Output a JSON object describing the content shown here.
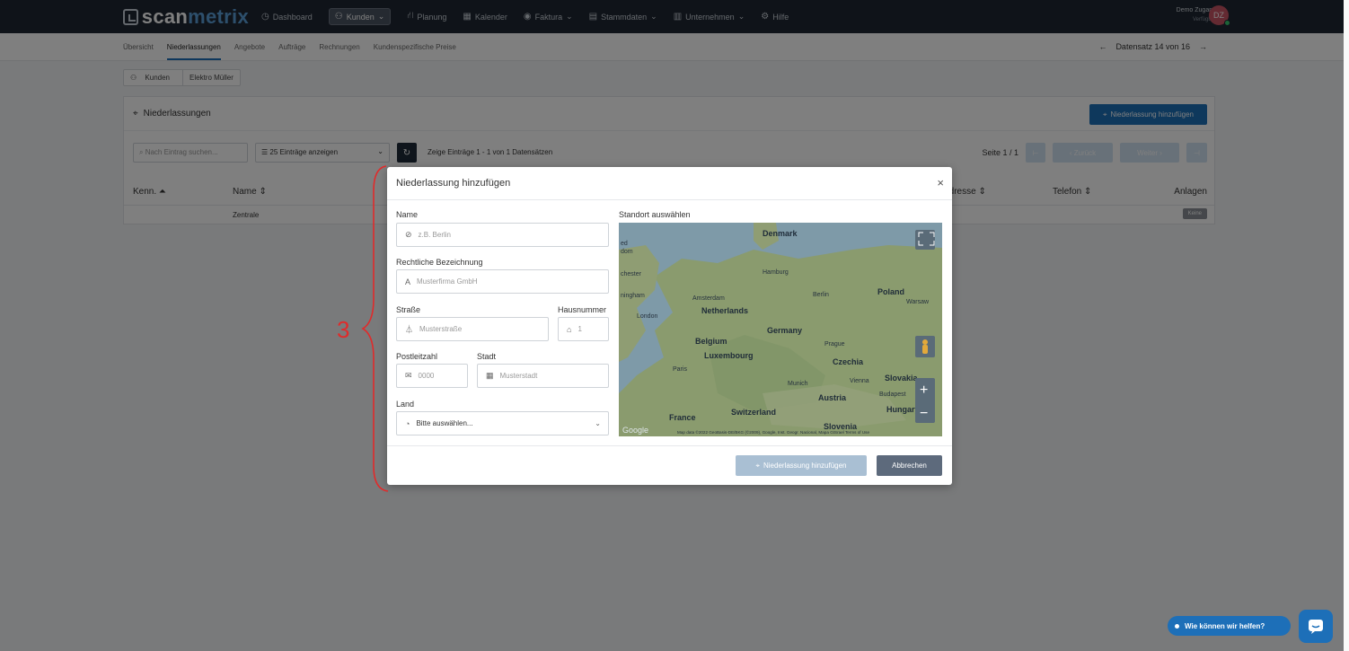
{
  "brand": {
    "part1": "scan",
    "part2": "metrix"
  },
  "nav": [
    {
      "label": "Dashboard",
      "icon": "dashboard-icon",
      "glyph": "◷"
    },
    {
      "label": "Kunden",
      "icon": "people-icon",
      "glyph": "⚇",
      "active": true,
      "chev": "⌄"
    },
    {
      "label": "Planung",
      "icon": "planning-icon",
      "glyph": "⛙"
    },
    {
      "label": "Kalender",
      "icon": "calendar-icon",
      "glyph": "▦"
    },
    {
      "label": "Faktura",
      "icon": "invoice-icon",
      "glyph": "◉",
      "chev": "⌄"
    },
    {
      "label": "Stammdaten",
      "icon": "database-icon",
      "glyph": "▤",
      "chev": "⌄"
    },
    {
      "label": "Unternehmen",
      "icon": "company-icon",
      "glyph": "▥",
      "chev": "⌄"
    },
    {
      "label": "Hilfe",
      "icon": "help-icon",
      "glyph": "⚙"
    }
  ],
  "user": {
    "name": "Demo Zugang",
    "status": "Verfügbar",
    "initials": "DZ"
  },
  "subnav": [
    "Übersicht",
    "Niederlassungen",
    "Angebote",
    "Aufträge",
    "Rechnungen",
    "Kundenspezifische Preise"
  ],
  "subnav_active": "Niederlassungen",
  "datensatz": {
    "prev": "←",
    "label": "Datensatz 14 von 16",
    "next": "→"
  },
  "breadcrumb": {
    "root": "Kunden",
    "current": "Elektro Müller"
  },
  "card": {
    "title": "Niederlassungen",
    "add_button": "Niederlassung hinzufügen",
    "search_placeholder": "Nach Eintrag suchen...",
    "entries": "25 Einträge anzeigen",
    "info": "Zeige Einträge 1 - 1 von 1 Datensätzen",
    "page": "Seite 1 / 1",
    "first": "⊢",
    "prev": "‹ Zurück",
    "next": "Weiter ›",
    "last": "⊣",
    "columns": {
      "kenn": "Kenn. ⏶",
      "name": "Name ⇕",
      "adresse": "Adresse ⇕",
      "telefon": "Telefon ⇕",
      "anlagen": "Anlagen"
    },
    "rows": [
      {
        "name": "Zentrale",
        "anlagen": "Keine"
      }
    ]
  },
  "modal": {
    "title": "Niederlassung hinzufügen",
    "close": "×",
    "name_label": "Name",
    "name_placeholder": "z.B. Berlin",
    "legal_label": "Rechtliche Bezeichnung",
    "legal_placeholder": "Musterfirma GmbH",
    "street_label": "Straße",
    "street_placeholder": "Musterstraße",
    "house_label": "Hausnummer",
    "house_placeholder": "1",
    "zip_label": "Postleitzahl",
    "zip_placeholder": "0000",
    "city_label": "Stadt",
    "city_placeholder": "Musterstadt",
    "country_label": "Land",
    "country_value": "Bitte auswählen...",
    "map_label": "Standort auswählen",
    "submit": "Niederlassung hinzufügen",
    "cancel": "Abbrechen"
  },
  "map": {
    "countries": [
      "Denmark",
      "Poland",
      "Netherlands",
      "Germany",
      "Belgium",
      "Luxembourg",
      "Czechia",
      "Austria",
      "France",
      "Switzerland",
      "Slovakia",
      "Hungary",
      "Slovenia"
    ],
    "cities": [
      "Hamburg",
      "Berlin",
      "Warsaw",
      "Amsterdam",
      "London",
      "Prague",
      "Paris",
      "Munich",
      "Vienna",
      "Budapest"
    ],
    "edge_labels": [
      "ed",
      "dom",
      "chester",
      "ningham"
    ],
    "attribution": "Map data ©2022 GeoBasis-DE/BKG (©2009), Google, Inst. Geogr. Nacional, Mapa GISrael   Terms of Use",
    "google": "Google",
    "zoom_in": "+",
    "zoom_out": "−"
  },
  "annotation": "3",
  "help": {
    "label": "Wie können wir helfen?"
  },
  "colors": {
    "topbar": "#1f2733",
    "accent": "#1d70b8",
    "land": "#8a9b6e",
    "water": "#7e9aa8",
    "annotation": "#e02b2b"
  }
}
